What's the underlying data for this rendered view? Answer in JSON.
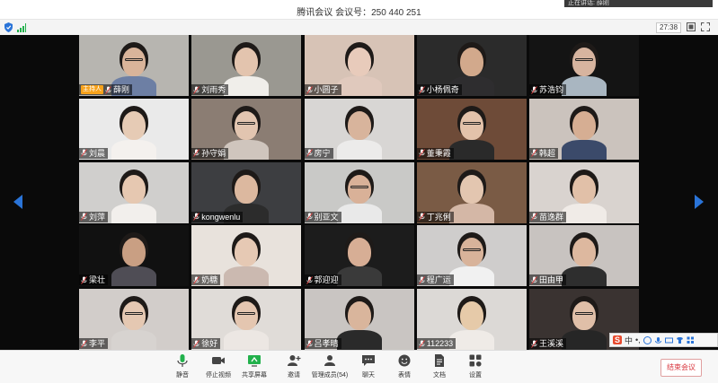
{
  "window": {
    "title": "腾讯会议 会议号：250 440 251",
    "tooltip": "正在讲话: 薛刚"
  },
  "status": {
    "timer": "27:38"
  },
  "host_badge": "主持人",
  "participants": [
    {
      "name": "薛刚",
      "host": true,
      "bg": "#b7b5b0",
      "skin": "#d9b49a",
      "shirt": "#6d7fa4",
      "glasses": true
    },
    {
      "name": "刘雨秀",
      "bg": "#9a9891",
      "skin": "#e3c4ae",
      "shirt": "#f0eeea"
    },
    {
      "name": "小圆子",
      "bg": "#d7c3b6",
      "skin": "#e8cbbb",
      "shirt": "#e0c9bd"
    },
    {
      "name": "小杨佩奇",
      "bg": "#2b2b2b",
      "skin": "#d2a98c",
      "shirt": "#2e2d2f"
    },
    {
      "name": "苏浩钧",
      "bg": "#141414",
      "skin": "#d7b49f",
      "shirt": "#a9b6c1",
      "glasses": true
    },
    {
      "name": "刘晨",
      "bg": "#eaeaea",
      "skin": "#e6cbb5",
      "shirt": "#f4f1ee"
    },
    {
      "name": "孙守娟",
      "bg": "#8b7d73",
      "skin": "#e2c5b0",
      "shirt": "#cfc5bd",
      "glasses": true
    },
    {
      "name": "房宁",
      "bg": "#d8d6d4",
      "skin": "#d8b49c",
      "shirt": "#ecebea"
    },
    {
      "name": "董秉霞",
      "bg": "#6e4b38",
      "skin": "#e3c2aa",
      "shirt": "#2a2a2a",
      "glasses": true
    },
    {
      "name": "韩超",
      "bg": "#cbc3bd",
      "skin": "#d6ae93",
      "shirt": "#3b4a6a"
    },
    {
      "name": "刘萍",
      "bg": "#d0cfcd",
      "skin": "#e6c8b1",
      "shirt": "#f2efec"
    },
    {
      "name": "kongwenlu",
      "bg": "#3d3e41",
      "skin": "#dcb89f",
      "shirt": "#2c2c2c"
    },
    {
      "name": "别亚文",
      "bg": "#c9c9c7",
      "skin": "#d9b198",
      "shirt": "#e9e9e9",
      "glasses": true
    },
    {
      "name": "丁兆俐",
      "bg": "#7a5b45",
      "skin": "#e3c6b0",
      "shirt": "#d4b7a6"
    },
    {
      "name": "苗逸群",
      "bg": "#d9d3cf",
      "skin": "#e1c0a8",
      "shirt": "#f0ebe7"
    },
    {
      "name": "梁壮",
      "bg": "#111111",
      "skin": "#c99f83",
      "shirt": "#4f4d55"
    },
    {
      "name": "奶糖",
      "bg": "#e8e2dc",
      "skin": "#e6c9b4",
      "shirt": "#cbb9b0"
    },
    {
      "name": "郭迎迎",
      "bg": "#1c1c1c",
      "skin": "#d7ae95",
      "shirt": "#3a3a3a"
    },
    {
      "name": "程广运",
      "bg": "#cfcdcc",
      "skin": "#d8b39a",
      "shirt": "#f1f1f1",
      "glasses": true
    },
    {
      "name": "田由甲",
      "bg": "#c8c3c0",
      "skin": "#ddb89f",
      "shirt": "#2e2e2e"
    },
    {
      "name": "李平",
      "bg": "#d2cdca",
      "skin": "#e5c8b2",
      "shirt": "#d7d3d0",
      "glasses": true
    },
    {
      "name": "徐好",
      "bg": "#e0dcd8",
      "skin": "#e4c6b0",
      "shirt": "#ece7e3",
      "glasses": true
    },
    {
      "name": "吕孝晴",
      "bg": "#c9c5c2",
      "skin": "#d9b59c",
      "shirt": "#2a2a2a"
    },
    {
      "name": "112233",
      "bg": "#dcd9d6",
      "skin": "#e6caa9",
      "shirt": "#efebe7"
    },
    {
      "name": "王溪溪",
      "bg": "#3a3331",
      "skin": "#e0bfa8",
      "shirt": "#262626",
      "glasses": true
    }
  ],
  "ime": {
    "brand": "S",
    "lang": "中",
    "punct": "•,"
  },
  "toolbar": {
    "mute": "静音",
    "stop_video": "停止视频",
    "share_screen": "共享屏幕",
    "invite": "邀请",
    "manage_members": "管理成员(54)",
    "chat": "聊天",
    "reactions": "表情",
    "docs": "文档",
    "settings": "设置",
    "end_meeting": "结束会议"
  },
  "colors": {
    "accent": "#2a74d8",
    "end": "#d9363e",
    "host": "#f7a21b",
    "mic_green": "#22b14c"
  }
}
